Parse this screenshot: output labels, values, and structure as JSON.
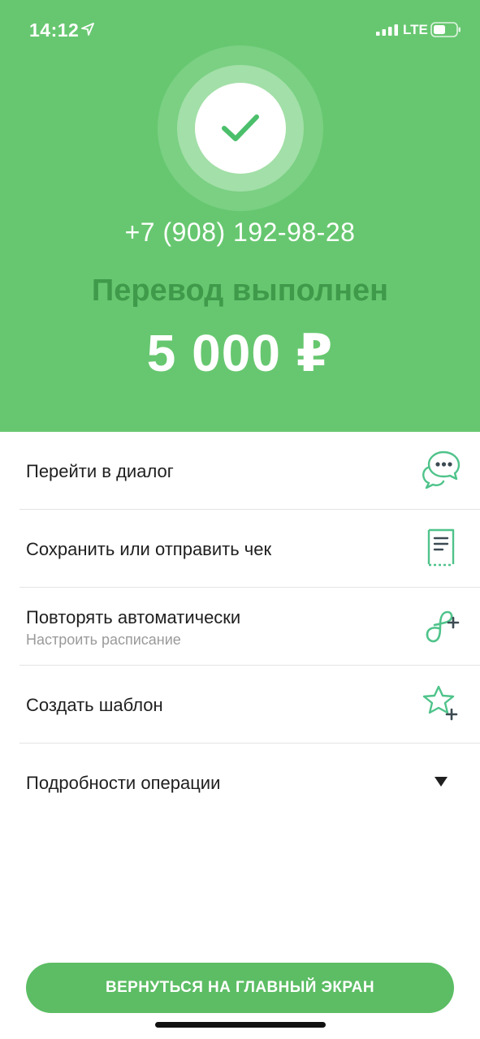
{
  "status_bar": {
    "time": "14:12",
    "network": "LTE",
    "icons": [
      "location-arrow-icon",
      "signal-bars-icon",
      "battery-icon"
    ]
  },
  "result": {
    "phone": "+7 (908) 192-98-28",
    "title": "Перевод выполнен",
    "amount": "5 000 ₽",
    "icon": "checkmark-icon"
  },
  "actions": [
    {
      "label": "Перейти в диалог",
      "icon": "chat-bubbles-icon"
    },
    {
      "label": "Сохранить или отправить чек",
      "icon": "receipt-icon"
    },
    {
      "label": "Повторять автоматически",
      "sublabel": "Настроить расписание",
      "icon": "repeat-plus-icon"
    },
    {
      "label": "Создать шаблон",
      "icon": "star-plus-icon"
    },
    {
      "label": "Подробности операции",
      "icon": "chevron-down-icon"
    }
  ],
  "footer": {
    "button_label": "ВЕРНУТЬСЯ НА ГЛАВНЫЙ ЭКРАН"
  },
  "colors": {
    "header_bg": "#67c770",
    "title_text": "#3f9a4a",
    "button_bg": "#5cbd64",
    "icon_accent": "#4fc38a"
  }
}
